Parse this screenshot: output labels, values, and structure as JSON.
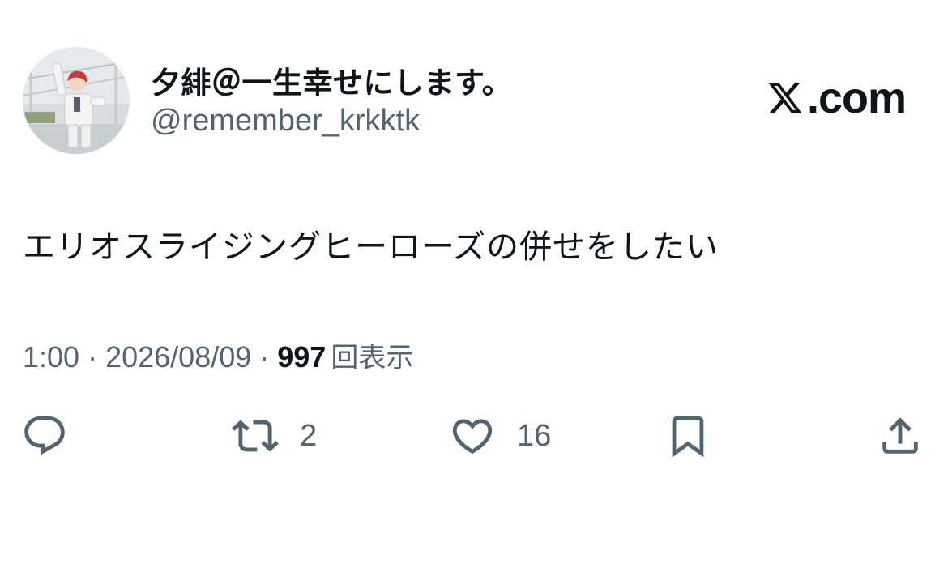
{
  "author": {
    "display_name": "夕緋＠一生幸せにします。",
    "handle": "@remember_krkktk"
  },
  "brand": {
    "label": ".com"
  },
  "tweet": {
    "text": "エリオスライジングヒーローズの併せをしたい",
    "time": "1:00",
    "separator": "·",
    "date": "2026/08/09",
    "views_count": "997",
    "views_label": "回表示"
  },
  "actions": {
    "retweets": "2",
    "likes": "16"
  },
  "icons": {
    "brand": "x-logo-icon",
    "reply": "reply-icon",
    "retweet": "retweet-icon",
    "like": "heart-icon",
    "bookmark": "bookmark-icon",
    "share": "share-icon"
  },
  "colors": {
    "text_primary": "#0f1419",
    "text_secondary": "#536471",
    "background": "#ffffff"
  }
}
